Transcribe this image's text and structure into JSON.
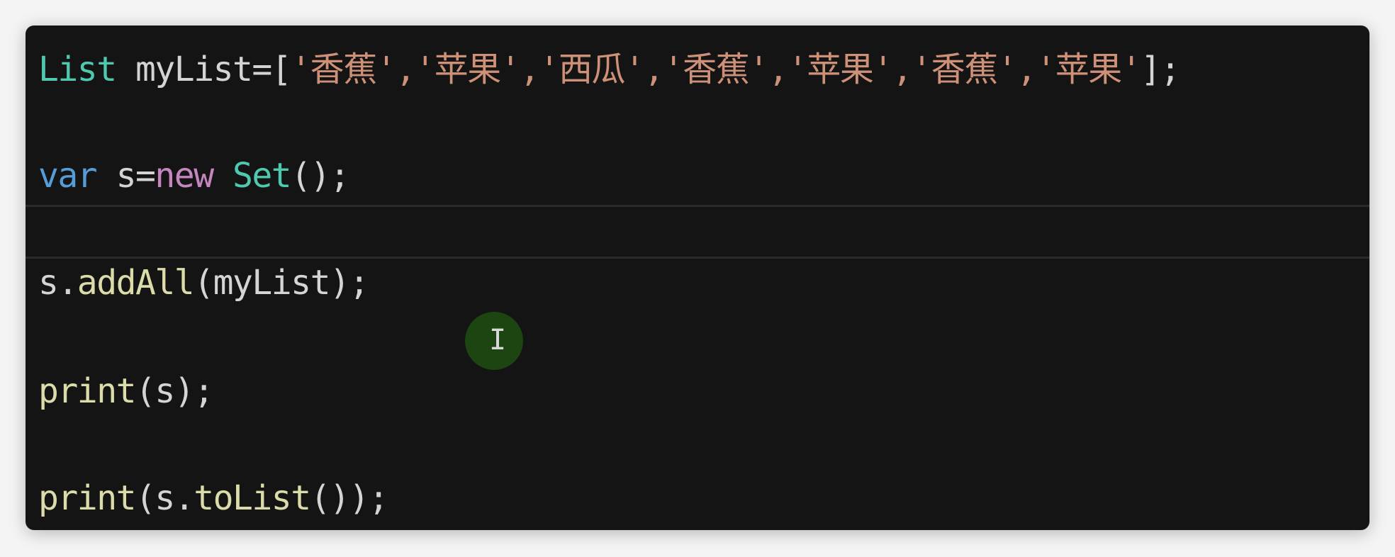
{
  "code": {
    "line1": {
      "type": "List",
      "ident": " myList=[",
      "items": "'香蕉','苹果','西瓜','香蕉','苹果','香蕉','苹果'",
      "end": "];"
    },
    "line2": {
      "kw": "var",
      "ident": " s=",
      "new": "new",
      "type": " Set",
      "end": "();"
    },
    "line3": {
      "obj": "s.",
      "fn": "addAll",
      "args": "(myList);"
    },
    "line4": {
      "fn": "print",
      "args": "(s);"
    },
    "line5": {
      "fn": "print",
      "a": "(s.",
      "fn2": "toList",
      "b": "());"
    }
  },
  "colors": {
    "background": "#141414",
    "type": "#4ec9b0",
    "keyword": "#569cd6",
    "control": "#c586c0",
    "string": "#ce9178",
    "function": "#dcdcaa"
  }
}
